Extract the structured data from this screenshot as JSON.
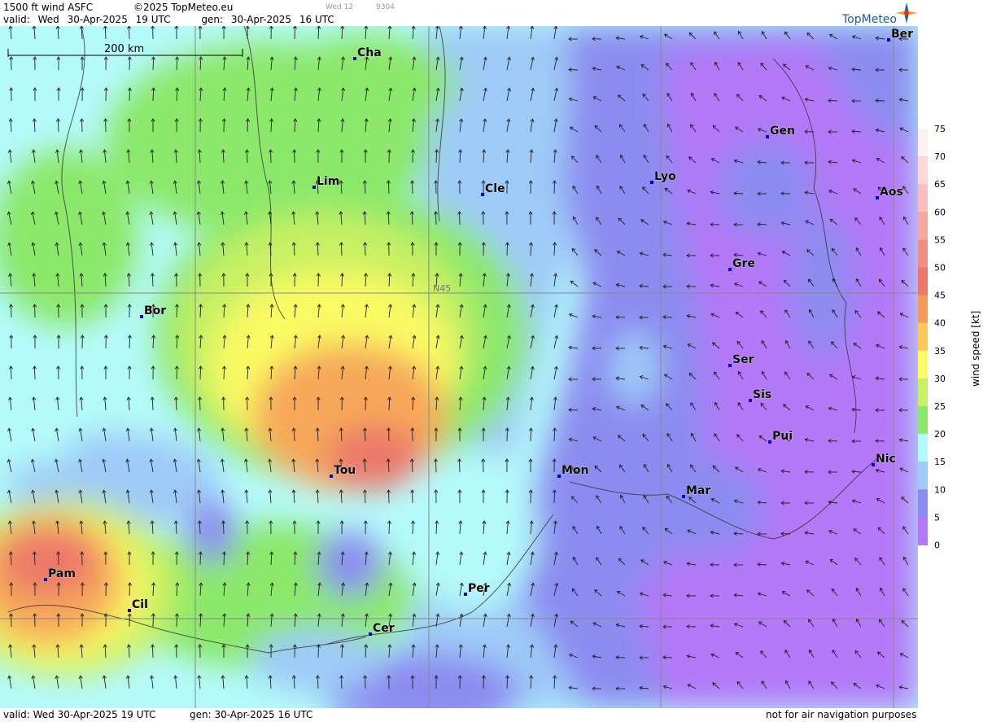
{
  "header": {
    "product": "1500 ft wind ASFC",
    "copyright": "©2025 TopMeteo.eu",
    "run_day": "Wed 12",
    "run_code": "9304",
    "valid_label": "valid:",
    "valid_day": "Wed",
    "valid_date": "30-Apr-2025",
    "valid_time": "19 UTC",
    "gen_label": "gen:",
    "gen_date": "30-Apr-2025",
    "gen_time": "16 UTC",
    "brand": "TopMeteo"
  },
  "footer": {
    "valid_text": "valid:  Wed  30-Apr-2025  19 UTC",
    "gen_text": "gen: 30-Apr-2025 16 UTC",
    "disclaimer": "not for air navigation purposes"
  },
  "scale_bar": {
    "label": "200 km"
  },
  "grid_label": "N45",
  "cities": [
    {
      "name": "Cha"
    },
    {
      "name": "Lim"
    },
    {
      "name": "Cle"
    },
    {
      "name": "Lyo"
    },
    {
      "name": "Gen"
    },
    {
      "name": "Ber"
    },
    {
      "name": "Aos"
    },
    {
      "name": "Gre"
    },
    {
      "name": "Bor"
    },
    {
      "name": "Ser"
    },
    {
      "name": "Sis"
    },
    {
      "name": "Pui"
    },
    {
      "name": "Nic"
    },
    {
      "name": "Tou"
    },
    {
      "name": "Mon"
    },
    {
      "name": "Mar"
    },
    {
      "name": "Pam"
    },
    {
      "name": "Cil"
    },
    {
      "name": "Per"
    },
    {
      "name": "Cer"
    }
  ],
  "legend": {
    "title": "wind speed [kt]",
    "ticks": [
      "75",
      "70",
      "65",
      "60",
      "55",
      "50",
      "45",
      "40",
      "35",
      "30",
      "25",
      "20",
      "15",
      "10",
      "5",
      "0"
    ],
    "colors": [
      "#fdf2f2",
      "#fbd8d8",
      "#f8c0bc",
      "#f4a8a0",
      "#f09084",
      "#ec786a",
      "#f39c5a",
      "#fbc85a",
      "#fafa64",
      "#c8f064",
      "#8ce86a",
      "#b4fafa",
      "#9ecaf8",
      "#8c8cf0",
      "#b478f8"
    ]
  },
  "colors": {
    "calm": "#b478f8",
    "light": "#8c8cf0",
    "moderate": "#9ecaf8",
    "cyan": "#b4fafa",
    "green": "#8ce86a",
    "yellowgreen": "#c8f064",
    "yellow": "#fafa64",
    "orange": "#f7a85a",
    "red": "#ec786a",
    "coast": "#333333",
    "brand": "#1a60a8"
  }
}
